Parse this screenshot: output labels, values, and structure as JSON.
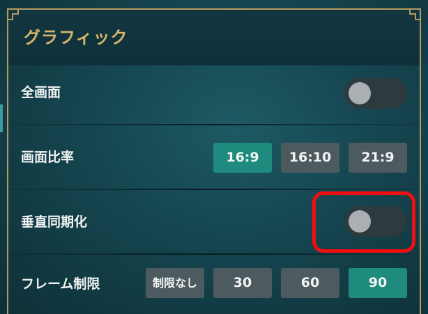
{
  "section": {
    "title": "グラフィック"
  },
  "settings": {
    "fullscreen": {
      "label": "全画面",
      "value": "off"
    },
    "aspect": {
      "label": "画面比率",
      "options": [
        "16:9",
        "16:10",
        "21:9"
      ],
      "selected": "16:9"
    },
    "vsync": {
      "label": "垂直同期化",
      "value": "off"
    },
    "frame_limit": {
      "label": "フレーム制限",
      "options": [
        "制限なし",
        "30",
        "60",
        "90"
      ],
      "selected": "90"
    }
  },
  "colors": {
    "accent": "#1f8a7e",
    "title_gold": "#d7b56a",
    "highlight": "#ef0f12"
  }
}
